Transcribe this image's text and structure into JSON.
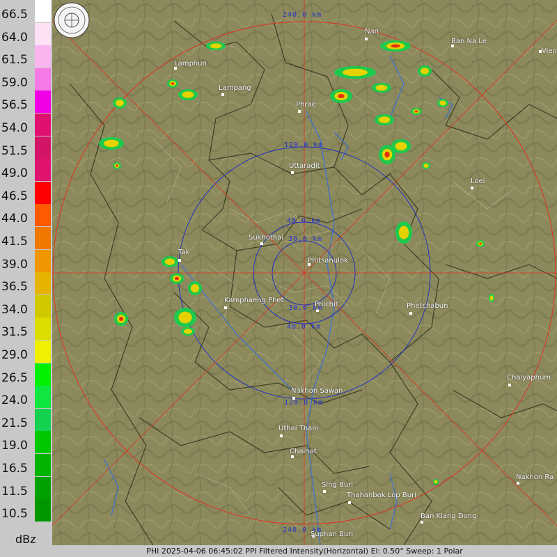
{
  "legend": {
    "unit": "dBz",
    "levels": [
      {
        "label": "66.5",
        "color": "#ffffff"
      },
      {
        "label": "64.0",
        "color": "#fde1f5"
      },
      {
        "label": "61.5",
        "color": "#fab4ef"
      },
      {
        "label": "59.0",
        "color": "#f57ae8"
      },
      {
        "label": "56.5",
        "color": "#f000e6"
      },
      {
        "label": "54.0",
        "color": "#e0106e"
      },
      {
        "label": "51.5",
        "color": "#d41466"
      },
      {
        "label": "49.0",
        "color": "#e0146e"
      },
      {
        "label": "46.5",
        "color": "#ff0000"
      },
      {
        "label": "44.0",
        "color": "#ff5a00"
      },
      {
        "label": "41.5",
        "color": "#f07800"
      },
      {
        "label": "39.0",
        "color": "#f09600"
      },
      {
        "label": "36.5",
        "color": "#e6b400"
      },
      {
        "label": "34.0",
        "color": "#d2c800"
      },
      {
        "label": "31.5",
        "color": "#dcdc00"
      },
      {
        "label": "29.0",
        "color": "#f0f000"
      },
      {
        "label": "26.5",
        "color": "#00f000"
      },
      {
        "label": "24.0",
        "color": "#10e640"
      },
      {
        "label": "21.5",
        "color": "#14d250"
      },
      {
        "label": "19.0",
        "color": "#00c800"
      },
      {
        "label": "16.5",
        "color": "#00b400"
      },
      {
        "label": "11.5",
        "color": "#00a000"
      },
      {
        "label": "10.5",
        "color": "#009600"
      }
    ]
  },
  "status_bar": "PHI 2025-04-06 06:45:02 PPI Filtered Intensity(Horizontal)  El: 0.50°  Sweep: 1 Polar",
  "seal_icon": "thai-met-department-seal-icon",
  "range_labels": [
    {
      "text": "240.0 km",
      "ring": "240-top"
    },
    {
      "text": "120.0 km",
      "ring": "120-top"
    },
    {
      "text": "48.0 km",
      "ring": "48-top"
    },
    {
      "text": "30.0 km",
      "ring": "30-top"
    },
    {
      "text": "30.0 km",
      "ring": "30-bottom"
    },
    {
      "text": "48.0 km",
      "ring": "48-bottom"
    },
    {
      "text": "120.0 km",
      "ring": "120-bottom"
    },
    {
      "text": "240.0 km",
      "ring": "240-bottom"
    }
  ],
  "cities": [
    {
      "name": "Nan"
    },
    {
      "name": "Ban Na Le"
    },
    {
      "name": "Vien"
    },
    {
      "name": "Lamphun"
    },
    {
      "name": "Lampang"
    },
    {
      "name": "Phrae"
    },
    {
      "name": "Uttaradit"
    },
    {
      "name": "Loei"
    },
    {
      "name": "Sukhothai"
    },
    {
      "name": "Phitsanulok"
    },
    {
      "name": "Tak"
    },
    {
      "name": "Kamphaeng Phet"
    },
    {
      "name": "Phichit"
    },
    {
      "name": "Phetchabun"
    },
    {
      "name": "Chaiyaphum"
    },
    {
      "name": "Nakhon Sawan"
    },
    {
      "name": "Uthai Thani"
    },
    {
      "name": "Chainat"
    },
    {
      "name": "Sing Buri"
    },
    {
      "name": "Thahanbok Lop Buri"
    },
    {
      "name": "Nakhon Ra"
    },
    {
      "name": "Ban Klang Dong"
    },
    {
      "name": "Suphan Buri"
    }
  ]
}
